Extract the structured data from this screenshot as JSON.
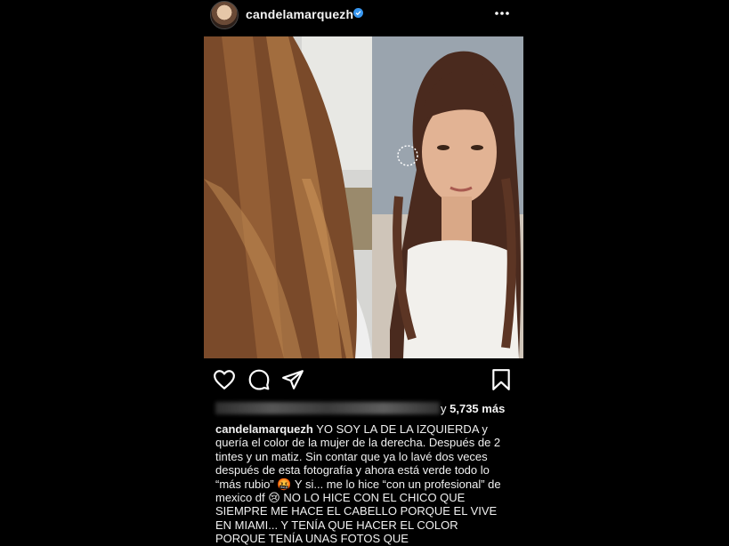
{
  "post": {
    "username": "candelamarquezh",
    "verified": true,
    "likes": {
      "prefix": "y",
      "count": "5,735",
      "suffix": "más"
    },
    "caption": {
      "username": "candelamarquezh",
      "text": "YO SOY LA DE LA IZQUIERDA y quería el color de la mujer de la derecha. Después de 2 tintes y un matiz. Sin contar que ya lo lavé dos veces después de esta fotografía y ahora está verde todo lo “más rubio” 🤬 Y si... me lo hice “con un profesional” de mexico df 😢 NO LO HICE CON EL CHICO QUE SIEMPRE ME HACE EL CABELLO PORQUE EL VIVE EN MIAMI... Y TENÍA QUE HACER EL COLOR PORQUE TENÍA UNAS FOTOS QUE"
    }
  },
  "icons": {
    "like": "heart-icon",
    "comment": "comment-icon",
    "share": "send-icon",
    "save": "bookmark-icon",
    "more": "more-options-icon",
    "verified": "verified-badge-icon"
  },
  "colors": {
    "background": "#000000",
    "verified": "#3897f0",
    "text": "#f5f5f5"
  }
}
